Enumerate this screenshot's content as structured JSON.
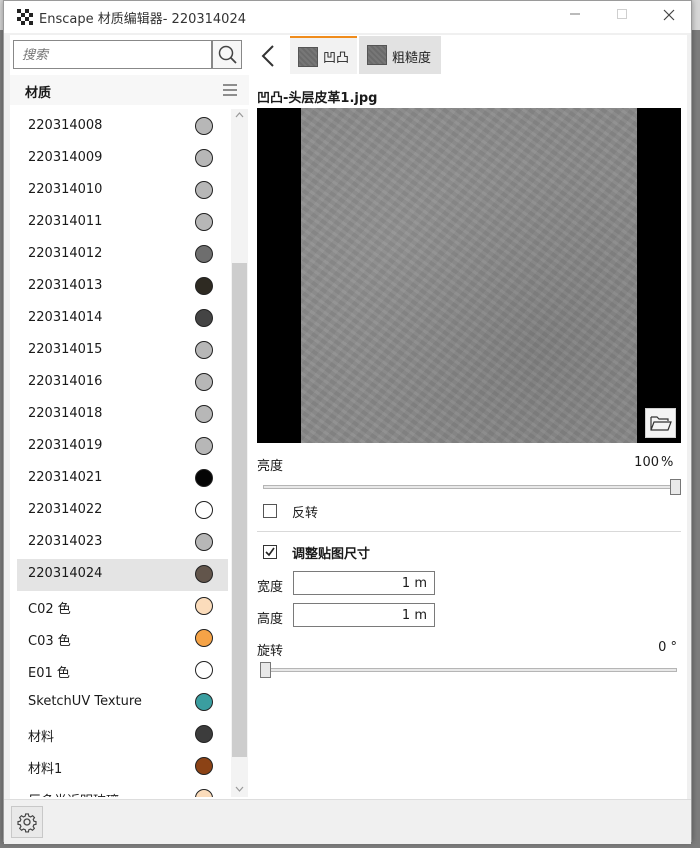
{
  "window": {
    "title": "Enscape 材质编辑器- 220314024"
  },
  "left_panel": {
    "search_placeholder": "搜索",
    "section_title": "材质",
    "materials": [
      {
        "name": "220314008",
        "color": "#b7b7b7"
      },
      {
        "name": "220314009",
        "color": "#b7b7b7"
      },
      {
        "name": "220314010",
        "color": "#b7b7b7"
      },
      {
        "name": "220314011",
        "color": "#b7b7b7"
      },
      {
        "name": "220314012",
        "color": "#6e6e6e"
      },
      {
        "name": "220314013",
        "color": "#2e2a22"
      },
      {
        "name": "220314014",
        "color": "#444444"
      },
      {
        "name": "220314015",
        "color": "#b7b7b7"
      },
      {
        "name": "220314016",
        "color": "#b7b7b7"
      },
      {
        "name": "220314018",
        "color": "#b7b7b7"
      },
      {
        "name": "220314019",
        "color": "#b7b7b7"
      },
      {
        "name": "220314021",
        "color": "#050505"
      },
      {
        "name": "220314022",
        "color": "#ffffff"
      },
      {
        "name": "220314023",
        "color": "#b7b7b7"
      },
      {
        "name": "220314024",
        "color": "#62554b",
        "selected": true
      },
      {
        "name": "C02 色",
        "color": "#fbdcbb"
      },
      {
        "name": "C03 色",
        "color": "#f5a347"
      },
      {
        "name": "E01 色",
        "color": "#ffffff"
      },
      {
        "name": "SketchUV Texture",
        "color": "#3a9ea0"
      },
      {
        "name": "材料",
        "color": "#3c3c3c"
      },
      {
        "name": "材料1",
        "color": "#8b4215"
      },
      {
        "name": "巨多半近明玻璃",
        "color": "#fbdcbb"
      }
    ]
  },
  "right_panel": {
    "tabs": [
      {
        "label": "凹凸"
      },
      {
        "label": "粗糙度"
      }
    ],
    "texture_name": "凹凸-头层皮革1.jpg",
    "brightness_label": "亮度",
    "brightness_value": "100",
    "brightness_unit": "%",
    "brightness_level": 1.0,
    "invert_label": "反转",
    "invert_checked": false,
    "resize_label": "调整贴图尺寸",
    "resize_checked": true,
    "width_label": "宽度",
    "width_value": "1 m",
    "height_label": "高度",
    "height_value": "1 m",
    "rotation_label": "旋转",
    "rotation_value": "0 °",
    "rotation_level": 0.0
  },
  "colors": {
    "accent_tab": "#f08c1c",
    "selected_row": "#e4e4e4"
  }
}
